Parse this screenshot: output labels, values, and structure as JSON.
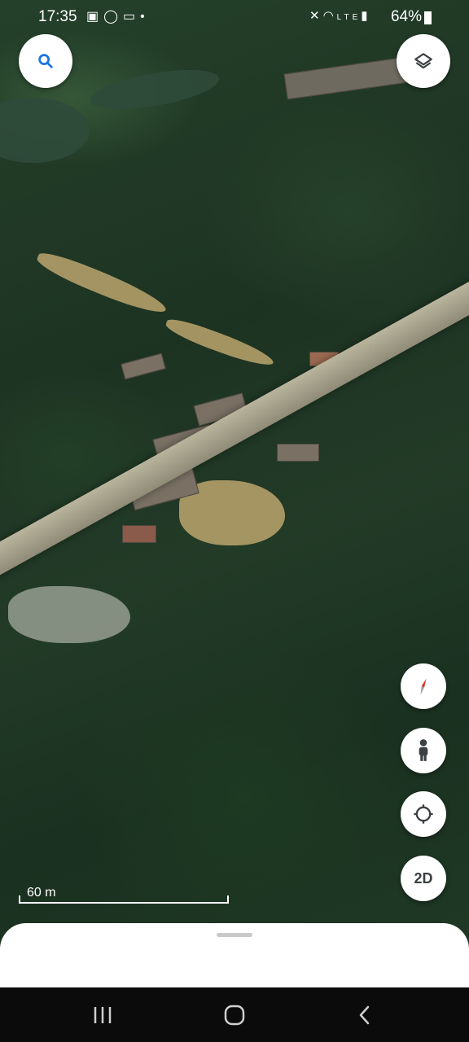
{
  "status_bar": {
    "time": "17:35",
    "left_icons": [
      "image-icon",
      "whatsapp-icon",
      "voicemail-icon",
      "dot"
    ],
    "right_icons": [
      "mute-icon",
      "wifi-icon",
      "volte-icon",
      "signal-icon"
    ],
    "battery": "64%"
  },
  "map": {
    "type": "satellite-3d",
    "scale_label": "60 m"
  },
  "controls": {
    "search": "search-icon",
    "layers": "layers-icon",
    "compass": "compass-icon",
    "street_view": "pegman-icon",
    "my_location": "crosshair-icon",
    "view_mode_label": "2D"
  },
  "navbar": [
    "recents",
    "home",
    "back"
  ],
  "colors": {
    "accent": "#1a73e8",
    "compass_red": "#d93025"
  }
}
